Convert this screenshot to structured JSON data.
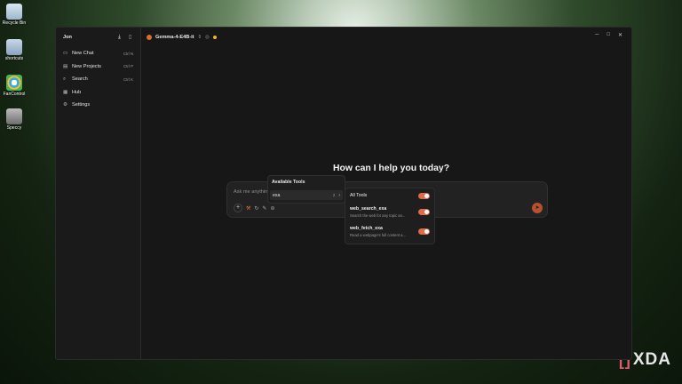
{
  "desktop": {
    "icons": [
      {
        "label": "Recycle Bin"
      },
      {
        "label": "shortcuts"
      },
      {
        "label": "FanControl"
      },
      {
        "label": "Speccy"
      }
    ]
  },
  "watermark": {
    "text": "XDA"
  },
  "sidebar": {
    "user": "Jon",
    "items": [
      {
        "label": "New Chat",
        "shortcut": "Ctrl N",
        "icon": "chat-icon"
      },
      {
        "label": "New Projects",
        "shortcut": "Ctrl P",
        "icon": "folder-icon"
      },
      {
        "label": "Search",
        "shortcut": "Ctrl K",
        "icon": "search-icon"
      },
      {
        "label": "Hub",
        "shortcut": "",
        "icon": "grid-icon"
      },
      {
        "label": "Settings",
        "shortcut": "",
        "icon": "gear-icon"
      }
    ]
  },
  "topbar": {
    "model": "Gemma-4-E4B-it"
  },
  "main": {
    "greeting": "How can I help you today?"
  },
  "composer": {
    "placeholder": "Ask me anything"
  },
  "tools_popover": {
    "title": "Available Tools",
    "server": {
      "name": "exa",
      "count": "2"
    }
  },
  "tools_submenu": {
    "all_label": "All Tools",
    "tools": [
      {
        "name": "web_search_exa",
        "description": "Search the web for any topic an..."
      },
      {
        "name": "web_fetch_exa",
        "description": "Read a webpage's full content a..."
      }
    ]
  },
  "colors": {
    "accent": "#e06a48",
    "status_dot": "#e9b92a"
  }
}
